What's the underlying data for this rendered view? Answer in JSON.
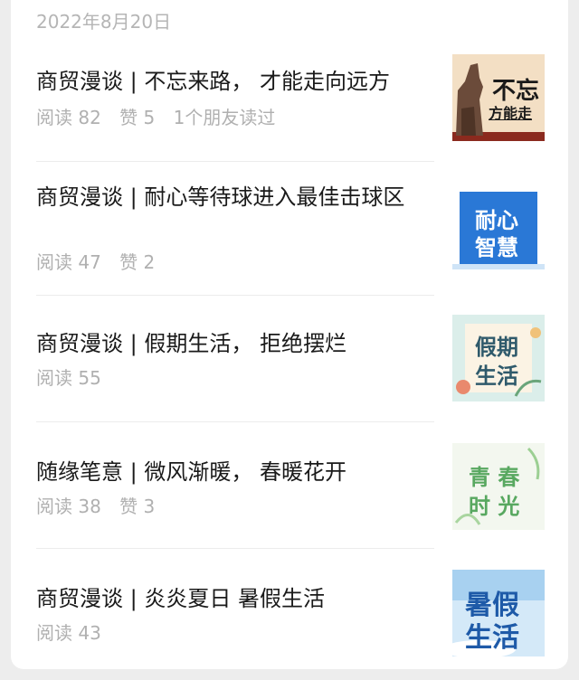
{
  "date": "2022年8月20日",
  "articles": [
    {
      "title": "商贸漫谈 | 不忘来路， 才能走向远方",
      "meta": [
        "阅读 82",
        "赞 5",
        "1个朋友读过"
      ],
      "thumb_text": [
        "不忘",
        "方能走"
      ]
    },
    {
      "title": "商贸漫谈 | 耐心等待球进入最佳击球区",
      "meta": [
        "阅读 47",
        "赞 2"
      ],
      "thumb_text": [
        "耐心",
        "智慧"
      ]
    },
    {
      "title": "商贸漫谈 | 假期生活， 拒绝摆烂",
      "meta": [
        "阅读 55"
      ],
      "thumb_text": [
        "假期",
        "生活"
      ]
    },
    {
      "title": "随缘笔意 | 微风渐暖， 春暖花开",
      "meta": [
        "阅读 38",
        "赞 3"
      ],
      "thumb_text": [
        "青 春",
        "时 光"
      ]
    },
    {
      "title": "商贸漫谈 | 炎炎夏日 暑假生活",
      "meta": [
        "阅读 43"
      ],
      "thumb_text": [
        "暑假",
        "生活"
      ]
    }
  ]
}
